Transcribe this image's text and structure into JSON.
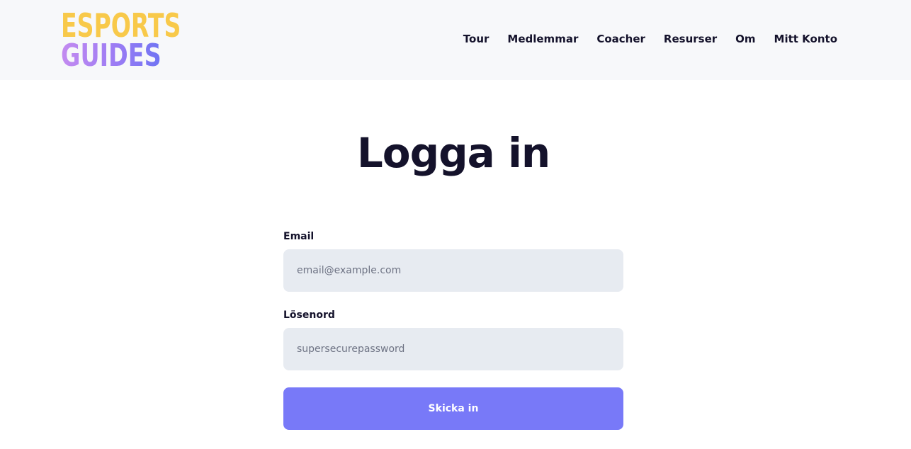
{
  "header": {
    "logo": {
      "line1": "ESPORTS",
      "line2": "GUIDES"
    },
    "nav": [
      {
        "label": "Tour"
      },
      {
        "label": "Medlemmar"
      },
      {
        "label": "Coacher"
      },
      {
        "label": "Resurser"
      },
      {
        "label": "Om"
      },
      {
        "label": "Mitt Konto"
      }
    ]
  },
  "main": {
    "title": "Logga in",
    "form": {
      "email": {
        "label": "Email",
        "value": "",
        "placeholder": "email@example.com"
      },
      "password": {
        "label": "Lösenord",
        "value": "",
        "placeholder": "supersecurepassword"
      },
      "submit_label": "Skicka in"
    }
  },
  "colors": {
    "header_bg": "#f7f8fa",
    "text_dark": "#14122b",
    "logo_yellow": "#f8c94a",
    "logo_purple": "#9b7cf4",
    "input_bg": "#e7ebf1",
    "button_bg": "#7879f8",
    "button_text": "#ffffff"
  }
}
